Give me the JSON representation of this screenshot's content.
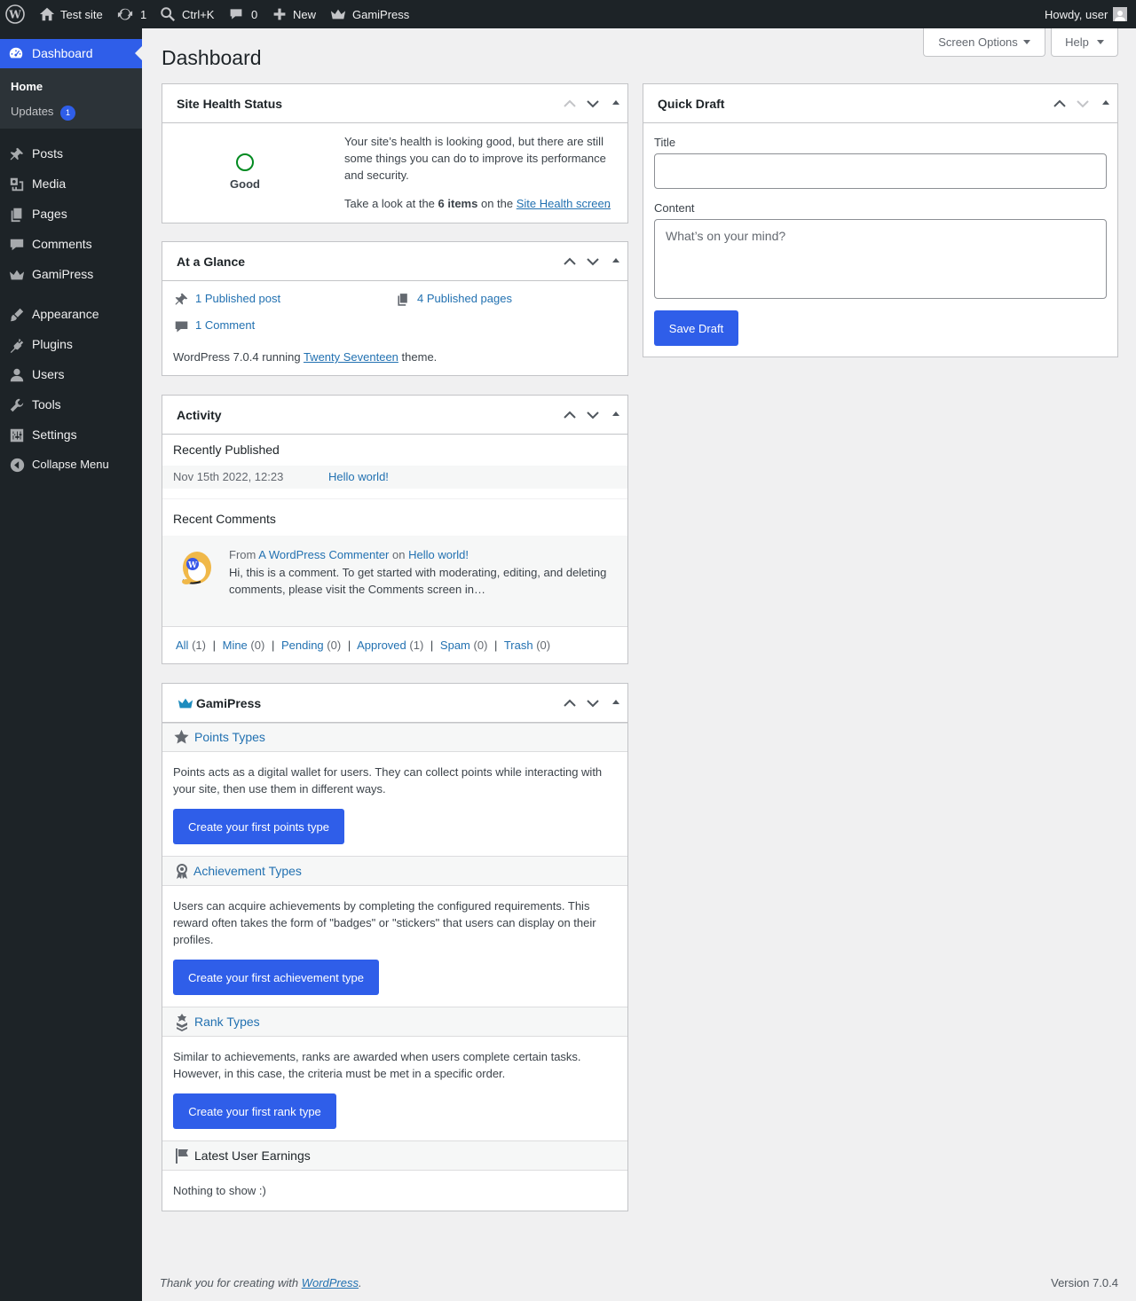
{
  "adminbar": {
    "site_name": "Test site",
    "updates_count": "1",
    "search_shortcut": "Ctrl+K",
    "comments_count": "0",
    "new_label": "New",
    "gamipress_label": "GamiPress",
    "howdy": "Howdy, user"
  },
  "sidebar": {
    "dashboard": "Dashboard",
    "home": "Home",
    "updates": "Updates",
    "updates_badge": "1",
    "items": [
      {
        "label": "Posts",
        "icon": "pin-icon"
      },
      {
        "label": "Media",
        "icon": "media-icon"
      },
      {
        "label": "Pages",
        "icon": "pages-icon"
      },
      {
        "label": "Comments",
        "icon": "comment-icon"
      },
      {
        "label": "GamiPress",
        "icon": "crown-icon"
      },
      {
        "label": "Appearance",
        "icon": "brush-icon"
      },
      {
        "label": "Plugins",
        "icon": "plug-icon"
      },
      {
        "label": "Users",
        "icon": "user-icon"
      },
      {
        "label": "Tools",
        "icon": "wrench-icon"
      },
      {
        "label": "Settings",
        "icon": "sliders-icon"
      }
    ],
    "collapse": "Collapse Menu"
  },
  "header": {
    "title": "Dashboard",
    "screen_options": "Screen Options",
    "help": "Help"
  },
  "site_health": {
    "title": "Site Health Status",
    "status": "Good",
    "description": "Your site’s health is looking good, but there are still some things you can do to improve its performance and security.",
    "look_prefix": "Take a look at the",
    "items_count": "6 items",
    "look_mid": "on the",
    "link": "Site Health screen",
    "period": "."
  },
  "glance": {
    "title": "At a Glance",
    "posts": "1 Published post",
    "pages": "4 Published pages",
    "comments": "1 Comment",
    "wp_prefix": "WordPress 7.0.4 running",
    "theme": "Twenty Seventeen",
    "wp_suffix": "theme."
  },
  "activity": {
    "title": "Activity",
    "recently_published": "Recently Published",
    "post_date": "Nov 15th 2022, 12:23",
    "post_title": "Hello world!",
    "recent_comments": "Recent Comments",
    "from": "From",
    "author": "A WordPress Commenter",
    "on": "on",
    "comment_post": "Hello world!",
    "excerpt": "Hi, this is a comment. To get started with moderating, editing, and deleting comments, please visit the Comments screen in…",
    "filters": [
      {
        "label": "All",
        "count": "(1)"
      },
      {
        "label": "Mine",
        "count": "(0)"
      },
      {
        "label": "Pending",
        "count": "(0)"
      },
      {
        "label": "Approved",
        "count": "(1)"
      },
      {
        "label": "Spam",
        "count": "(0)"
      },
      {
        "label": "Trash",
        "count": "(0)"
      }
    ],
    "separator": "|"
  },
  "gamipress": {
    "title": "GamiPress",
    "points_title": "Points Types",
    "points_desc": "Points acts as a digital wallet for users. They can collect points while interacting with your site, then use them in different ways.",
    "points_button": "Create your first points type",
    "achievements_title": "Achievement Types",
    "achievements_desc": "Users can acquire achievements by completing the configured requirements. This reward often takes the form of \"badges\" or \"stickers\" that users can display on their profiles.",
    "achievements_button": "Create your first achievement type",
    "ranks_title": "Rank Types",
    "ranks_desc": "Similar to achievements, ranks are awarded when users complete certain tasks. However, in this case, the criteria must be met in a specific order.",
    "ranks_button": "Create your first rank type",
    "earnings_title": "Latest User Earnings",
    "earnings_empty": "Nothing to show :)"
  },
  "quick_draft": {
    "title": "Quick Draft",
    "title_label": "Title",
    "title_value": "",
    "content_label": "Content",
    "content_placeholder": "What’s on your mind?",
    "save": "Save Draft"
  },
  "footer": {
    "thanks_prefix": "Thank you for creating with",
    "wordpress": "WordPress",
    "thanks_suffix": ".",
    "version": "Version 7.0.4"
  },
  "colors": {
    "accent": "#2f5ee9",
    "link": "#2271b1",
    "sidebar_bg": "#1d2327",
    "health_good": "#008a20"
  }
}
